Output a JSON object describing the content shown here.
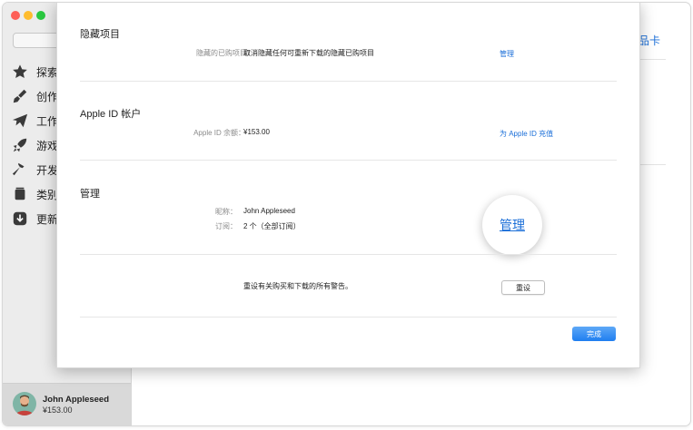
{
  "sidebar": {
    "items": [
      {
        "label": "探索",
        "icon": "star-icon"
      },
      {
        "label": "创作",
        "icon": "brush-icon"
      },
      {
        "label": "工作",
        "icon": "paper-plane-icon"
      },
      {
        "label": "游戏",
        "icon": "rocket-icon"
      },
      {
        "label": "开发",
        "icon": "hammer-icon"
      },
      {
        "label": "类别",
        "icon": "stack-icon"
      },
      {
        "label": "更新",
        "icon": "download-icon"
      }
    ],
    "user": {
      "name": "John Appleseed",
      "balance": "¥153.00"
    }
  },
  "background": {
    "gift_card_link": "礼品卡"
  },
  "sheet": {
    "hidden": {
      "title": "隐藏项目",
      "label": "隐藏的已购项目：",
      "value": "取消隐藏任何可重新下载的隐藏已购项目",
      "link": "管理"
    },
    "apple_id": {
      "title": "Apple ID 帐户",
      "label": "Apple ID 余额：",
      "value": "¥153.00",
      "link": "为 Apple ID 充值"
    },
    "manage": {
      "title": "管理",
      "nickname_label": "昵称：",
      "nickname_value": "John Appleseed",
      "subs_label": "订阅：",
      "subs_value": "2 个（全部订阅）",
      "link": "管理"
    },
    "reset": {
      "text": "重设有关购买和下载的所有警告。",
      "button": "重设"
    },
    "done_button": "完成"
  }
}
